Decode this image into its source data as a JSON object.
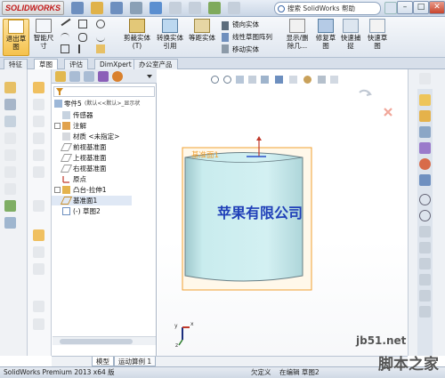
{
  "titlebar": {
    "logo": "SOLIDWORKS",
    "search_placeholder": "搜索 SolidWorks 帮助"
  },
  "commands": {
    "exit_sketch": "退出草图",
    "smart_dimension": "智能尺寸",
    "trim_entities": "剪裁实体(T)",
    "convert_entities": "转换实体引用",
    "offset_entities": "等距实体",
    "mirror_entities": "镜向实体",
    "linear_pattern": "线性草图阵列",
    "move_entities": "移动实体",
    "display_relations": "显示/删除几...",
    "repair_sketch": "修复草图",
    "quick_snaps": "快速捕捉",
    "rapid_sketch": "快速草图"
  },
  "tabs": [
    "特征",
    "草图",
    "评估",
    "DimXpert",
    "办公室产品"
  ],
  "tree": {
    "root": "零件5",
    "root_config": "(默认<<默认>_显示状",
    "items": [
      {
        "label": "传感器"
      },
      {
        "label": "注解"
      },
      {
        "label": "材质 <未指定>"
      },
      {
        "label": "前视基准面"
      },
      {
        "label": "上视基准面"
      },
      {
        "label": "右视基准面"
      },
      {
        "label": "原点"
      },
      {
        "label": "凸台-拉伸1"
      },
      {
        "label": "基准面1"
      },
      {
        "label": "(-) 草图2"
      }
    ]
  },
  "graphics": {
    "plane_label": "基准面1",
    "sketch_text": "苹果有限公司",
    "triad_x": "x",
    "triad_y": "y",
    "triad_z": "z"
  },
  "model_tabs": [
    "模型",
    "运动算例 1"
  ],
  "status": {
    "product": "SolidWorks Premium 2013 x64 版",
    "constraint": "欠定义",
    "editing": "在编辑 草图2"
  },
  "watermark": {
    "site": "jb51.net",
    "name": "脚本之家"
  },
  "colors": {
    "cylinder": "#c9ecee",
    "plane": "#f0a030",
    "sketch_text": "#1f3fb8",
    "brand": "#c21818"
  }
}
